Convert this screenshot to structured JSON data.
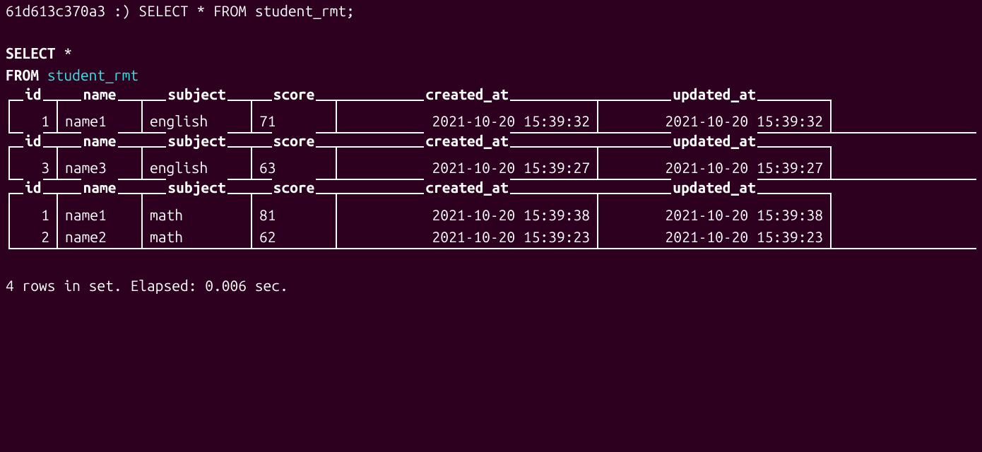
{
  "prompt": {
    "host": "61d613c370a3",
    "symbol": ":)",
    "command": "SELECT * FROM student_rmt;"
  },
  "query_echo": {
    "select": "SELECT",
    "star": "*",
    "from": "FROM",
    "table": "student_rmt"
  },
  "columns": {
    "id": "id",
    "name": "name",
    "subject": "subject",
    "score": "score",
    "created_at": "created_at",
    "updated_at": "updated_at"
  },
  "blocks": [
    {
      "rows": [
        {
          "id": "1",
          "name": "name1",
          "subject": "english",
          "score": "71",
          "created_at": "2021-10-20 15:39:32",
          "updated_at": "2021-10-20 15:39:32"
        }
      ]
    },
    {
      "rows": [
        {
          "id": "3",
          "name": "name3",
          "subject": "english",
          "score": "63",
          "created_at": "2021-10-20 15:39:27",
          "updated_at": "2021-10-20 15:39:27"
        }
      ]
    },
    {
      "rows": [
        {
          "id": "1",
          "name": "name1",
          "subject": "math",
          "score": "81",
          "created_at": "2021-10-20 15:39:38",
          "updated_at": "2021-10-20 15:39:38"
        },
        {
          "id": "2",
          "name": "name2",
          "subject": "math",
          "score": "62",
          "created_at": "2021-10-20 15:39:23",
          "updated_at": "2021-10-20 15:39:23"
        }
      ]
    }
  ],
  "footer": "4 rows in set. Elapsed: 0.006 sec."
}
